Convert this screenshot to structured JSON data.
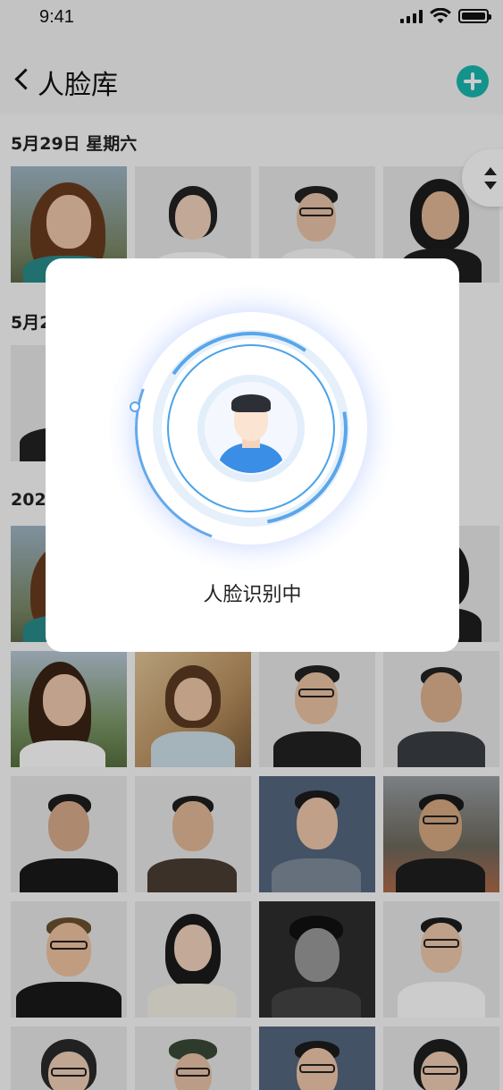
{
  "status_bar": {
    "time": "9:41"
  },
  "nav": {
    "back_icon": "chevron-left-icon",
    "title": "人脸库",
    "add_icon": "plus-icon"
  },
  "accent_color": "#18b8b0",
  "sections": [
    {
      "title": "5月29日  星期六"
    },
    {
      "title": "5月2"
    },
    {
      "title": "202"
    }
  ],
  "dialog": {
    "label": "人脸识别中"
  }
}
